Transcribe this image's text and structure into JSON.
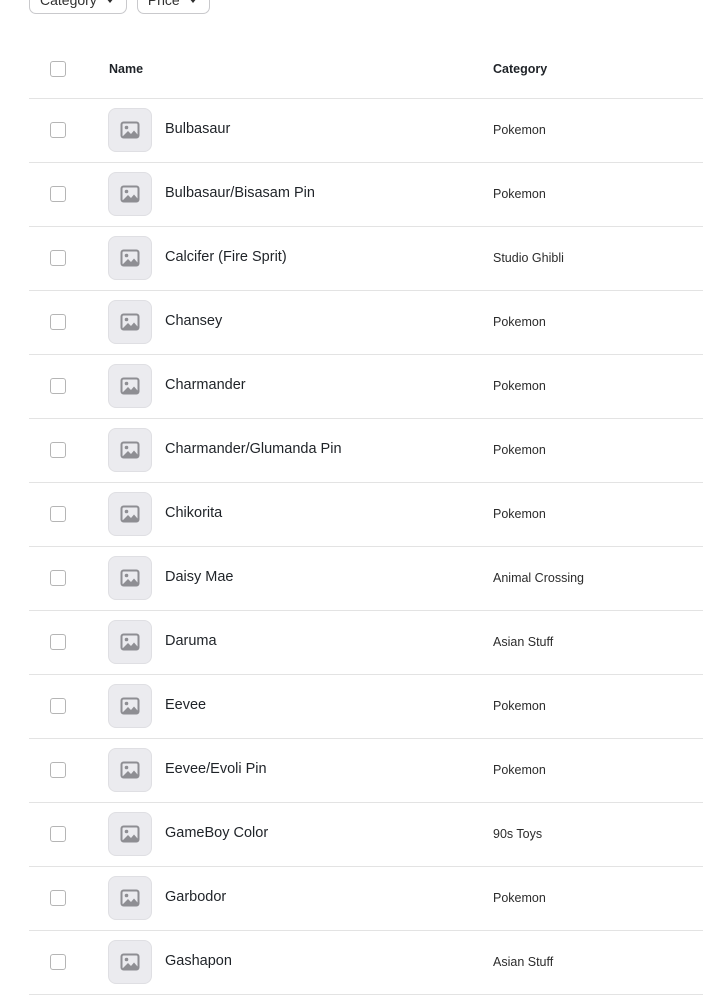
{
  "filters": {
    "category_label": "Category",
    "price_label": "Price"
  },
  "table": {
    "headers": {
      "name": "Name",
      "category": "Category"
    },
    "rows": [
      {
        "name": "Bulbasaur",
        "category": "Pokemon"
      },
      {
        "name": "Bulbasaur/Bisasam Pin",
        "category": "Pokemon"
      },
      {
        "name": "Calcifer (Fire Sprit)",
        "category": "Studio Ghibli"
      },
      {
        "name": "Chansey",
        "category": "Pokemon"
      },
      {
        "name": "Charmander",
        "category": "Pokemon"
      },
      {
        "name": "Charmander/Glumanda Pin",
        "category": "Pokemon"
      },
      {
        "name": "Chikorita",
        "category": "Pokemon"
      },
      {
        "name": "Daisy Mae",
        "category": "Animal Crossing"
      },
      {
        "name": "Daruma",
        "category": "Asian Stuff"
      },
      {
        "name": "Eevee",
        "category": "Pokemon"
      },
      {
        "name": "Eevee/Evoli Pin",
        "category": "Pokemon"
      },
      {
        "name": "GameBoy Color",
        "category": "90s Toys"
      },
      {
        "name": "Garbodor",
        "category": "Pokemon"
      },
      {
        "name": "Gashapon",
        "category": "Asian Stuff"
      }
    ]
  },
  "icons": {
    "thumbnail": "image-placeholder-icon",
    "caret": "chevron-down-icon"
  }
}
